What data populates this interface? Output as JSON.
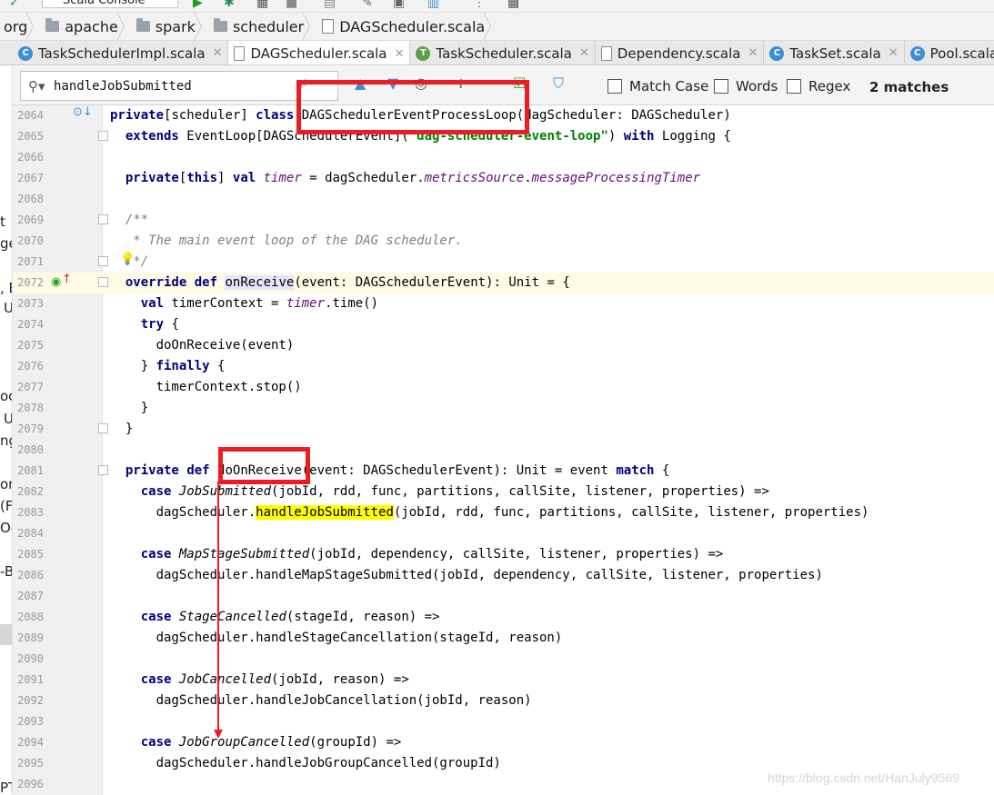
{
  "toolbar": {
    "run_config": "Scala Console"
  },
  "breadcrumb": [
    {
      "label": "org",
      "type": "folder"
    },
    {
      "label": "apache",
      "type": "folder"
    },
    {
      "label": "spark",
      "type": "folder"
    },
    {
      "label": "scheduler",
      "type": "folder"
    },
    {
      "label": "DAGScheduler.scala",
      "type": "file"
    }
  ],
  "tabs": [
    {
      "label": "TaskSchedulerImpl.scala",
      "icon": "C",
      "icon_color": "#3c8fd6",
      "active": false
    },
    {
      "label": "DAGScheduler.scala",
      "icon": "file",
      "icon_color": "#7c8692",
      "active": true
    },
    {
      "label": "TaskScheduler.scala",
      "icon": "T",
      "icon_color": "#5ba14c",
      "active": false
    },
    {
      "label": "Dependency.scala",
      "icon": "file",
      "icon_color": "#7c8692",
      "active": false
    },
    {
      "label": "TaskSet.scala",
      "icon": "C",
      "icon_color": "#3c8fd6",
      "active": false
    },
    {
      "label": "Pool.scala",
      "icon": "C",
      "icon_color": "#3c8fd6",
      "active": false
    }
  ],
  "search": {
    "value": "handleJobSubmitted",
    "options": {
      "match_case": "Match Case",
      "words": "Words",
      "regex": "Regex"
    },
    "match_count": "2 matches"
  },
  "editor": {
    "lines": [
      {
        "n": "2064"
      },
      {
        "n": "2065"
      },
      {
        "n": "2066"
      },
      {
        "n": "2067"
      },
      {
        "n": "2068"
      },
      {
        "n": "2069"
      },
      {
        "n": "2070"
      },
      {
        "n": "2071"
      },
      {
        "n": "2072"
      },
      {
        "n": "2073"
      },
      {
        "n": "2074"
      },
      {
        "n": "2075"
      },
      {
        "n": "2076"
      },
      {
        "n": "2077"
      },
      {
        "n": "2078"
      },
      {
        "n": "2079"
      },
      {
        "n": "2080"
      },
      {
        "n": "2081"
      },
      {
        "n": "2082"
      },
      {
        "n": "2083"
      },
      {
        "n": "2084"
      },
      {
        "n": "2085"
      },
      {
        "n": "2086"
      },
      {
        "n": "2087"
      },
      {
        "n": "2088"
      },
      {
        "n": "2089"
      },
      {
        "n": "2090"
      },
      {
        "n": "2091"
      },
      {
        "n": "2092"
      },
      {
        "n": "2093"
      },
      {
        "n": "2094"
      },
      {
        "n": "2095"
      },
      {
        "n": "2096"
      }
    ]
  },
  "left_strip": {
    "fragments": [
      "t",
      "ge",
      ", E",
      "U",
      "oc",
      "U",
      "ng",
      "on",
      "(F",
      "Oc",
      "-B",
      "PT"
    ]
  },
  "watermark": "https://blog.csdn.net/HanJuly9569"
}
